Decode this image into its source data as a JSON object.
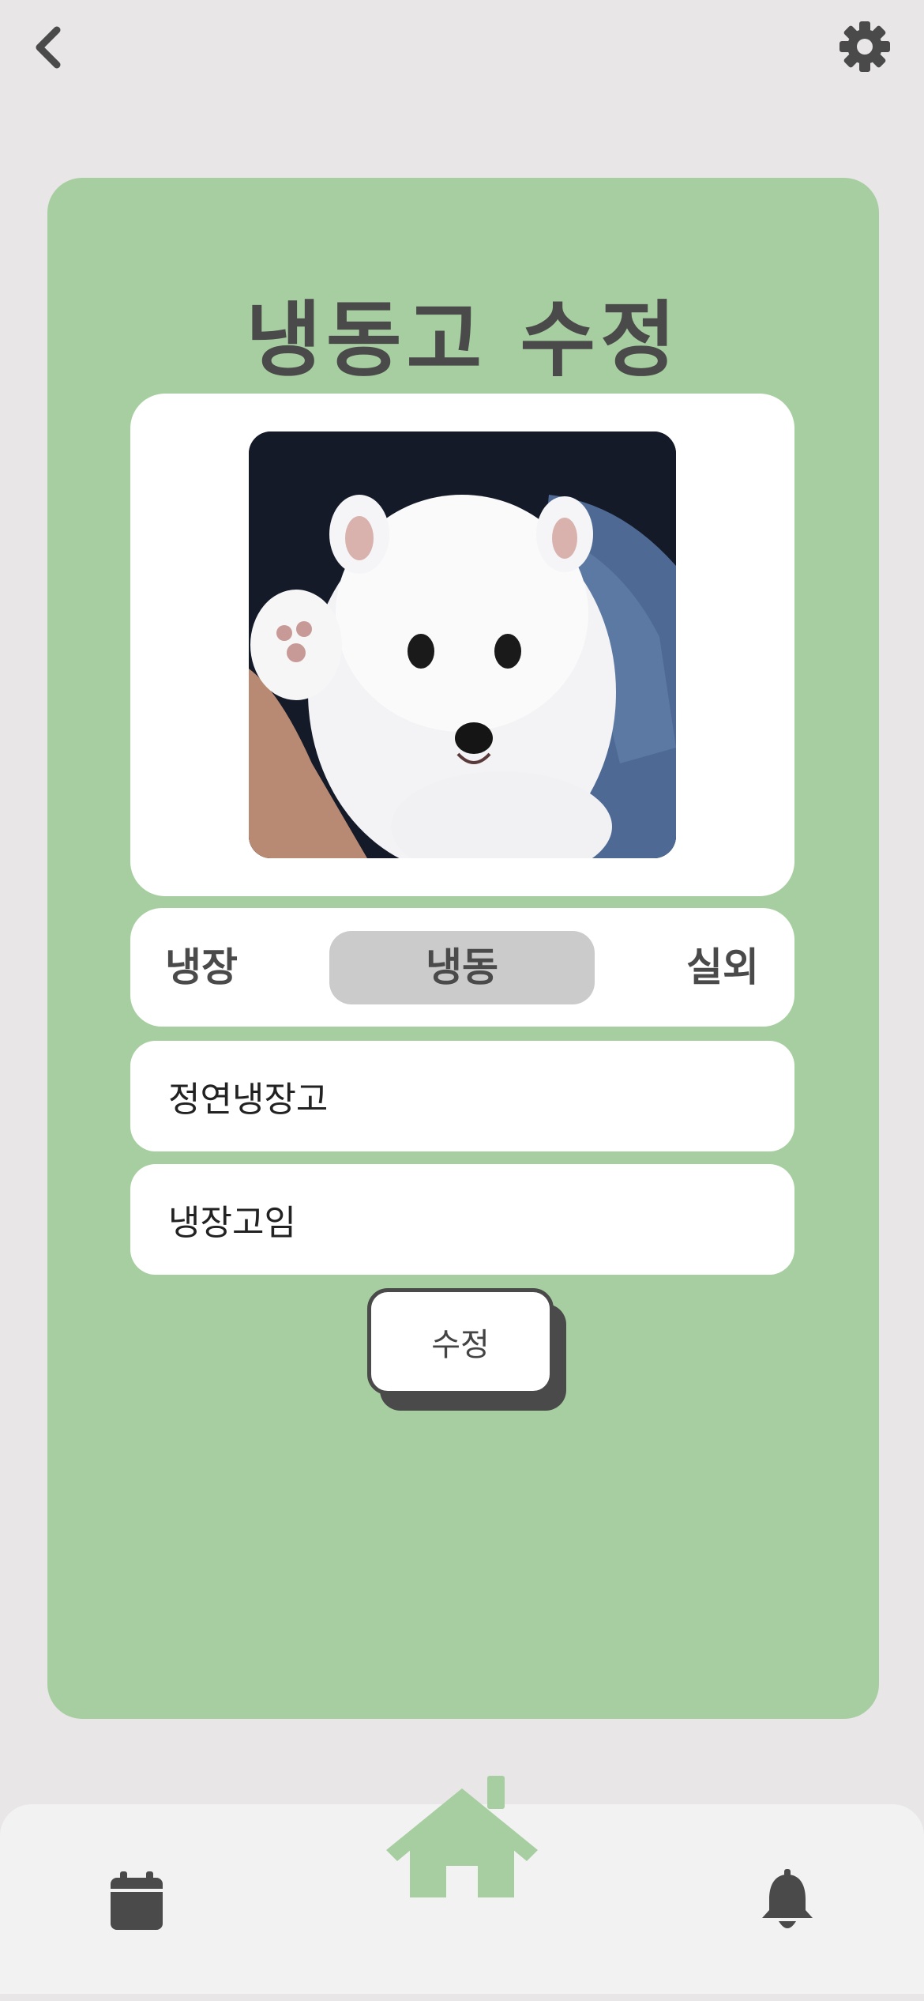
{
  "topbar": {
    "back_icon": "chevron-left-icon",
    "settings_icon": "gear-icon"
  },
  "form": {
    "title": "냉동고 수정",
    "photo_alt": "white fluffy puppy",
    "storage_options": [
      "냉장",
      "냉동",
      "실외"
    ],
    "selected_storage": "냉동",
    "name_value": "정연냉장고",
    "description_value": "냉장고임",
    "submit_label": "수정"
  },
  "bottom_nav": {
    "calendar_icon": "calendar-icon",
    "home_icon": "home-icon",
    "bell_icon": "bell-icon"
  },
  "colors": {
    "background": "#e8e6e7",
    "card": "#a7cea0",
    "accent_home": "#a7cea0",
    "text_dark": "#4a4a4a",
    "segment_selected": "#cbcbcb"
  }
}
